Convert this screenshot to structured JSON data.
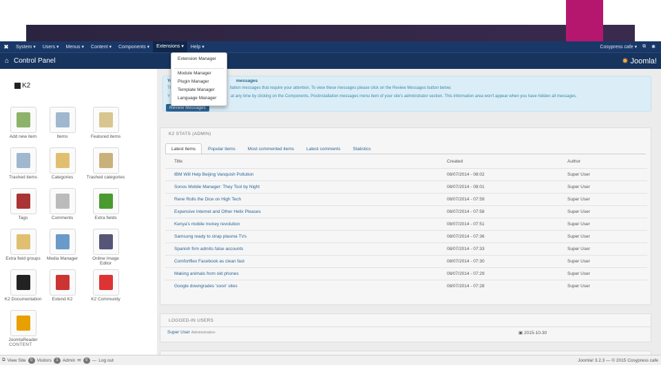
{
  "colors": {
    "menubar": "#1a3867",
    "header": "#17345f",
    "accent": "#b5176f",
    "link": "#2a6496",
    "info": "#dbeef7"
  },
  "menubar": {
    "items": [
      "System ▾",
      "Users ▾",
      "Menus ▾",
      "Content ▾",
      "Components ▾",
      "Extensions ▾",
      "Help ▾"
    ],
    "user": "Cosypress cafe ▾",
    "ext_icon": "external-link-icon",
    "settings_icon": "gear-icon"
  },
  "header": {
    "title": "Control Panel",
    "brand": "Joomla!"
  },
  "dropdown": [
    "Extension Manager",
    "Module Manager",
    "Plugin Manager",
    "Template Manager",
    "Language Manager"
  ],
  "k2": {
    "title": "K2",
    "tiles": [
      {
        "label": "Add new item",
        "icon": "add-item-icon",
        "color": "#8db36a"
      },
      {
        "label": "Items",
        "icon": "items-icon",
        "color": "#9fb7cf"
      },
      {
        "label": "Featured items",
        "icon": "featured-items-icon",
        "color": "#d9c58f"
      },
      {
        "label": "Trashed items",
        "icon": "trashed-items-icon",
        "color": "#9fb7cf"
      },
      {
        "label": "Categories",
        "icon": "categories-icon",
        "color": "#e0c070"
      },
      {
        "label": "Trashed categories",
        "icon": "trashed-categories-icon",
        "color": "#c9b27a"
      },
      {
        "label": "Tags",
        "icon": "tags-icon",
        "color": "#a33"
      },
      {
        "label": "Comments",
        "icon": "comments-icon",
        "color": "#bbb"
      },
      {
        "label": "Extra fields",
        "icon": "extra-fields-icon",
        "color": "#4a9a30"
      },
      {
        "label": "Extra field groups",
        "icon": "extra-field-groups-icon",
        "color": "#e0c070"
      },
      {
        "label": "Media Manager",
        "icon": "media-manager-icon",
        "color": "#6a9ac9"
      },
      {
        "label": "Online Image Editor",
        "icon": "image-editor-icon",
        "color": "#557"
      },
      {
        "label": "K2 Documentation",
        "icon": "documentation-icon",
        "color": "#222"
      },
      {
        "label": "Extend K2",
        "icon": "extend-icon",
        "color": "#c33"
      },
      {
        "label": "K2 Community",
        "icon": "community-icon",
        "color": "#d33"
      },
      {
        "label": "JoomlaReader",
        "icon": "joomlareader-icon",
        "color": "#e8a000"
      }
    ],
    "content_label": "CONTENT"
  },
  "alert": {
    "heading_a": "Yo",
    "heading_b": "messages",
    "line1_a": "Th",
    "line1_b": "llation messages that require your attention. To view these messages please click on the Review Messages button below.",
    "line2_a": "Y",
    "line2_b": "at any time by clicking on the Components, Postinstallation messages menu item of your site's administrator section. This information area won't appear when you have hidden all messages.",
    "button": "Review Messages"
  },
  "stats": {
    "title": "K2 STATS (ADMIN)",
    "tabs": [
      "Latest items",
      "Popular items",
      "Most commented items",
      "Latest comments",
      "Statistics"
    ],
    "columns": [
      "Title",
      "Created",
      "Author"
    ],
    "rows": [
      {
        "title": "IBM Will Help Beijing Vanquish Pollution",
        "created": "08/07/2014 - 08:02",
        "author": "Super User"
      },
      {
        "title": "Sonos Mobile Manager: They Tool by Night",
        "created": "08/07/2014 - 08:01",
        "author": "Super User"
      },
      {
        "title": "Rene Rolls the Dice on High Tech",
        "created": "08/07/2014 - 07:59",
        "author": "Super User"
      },
      {
        "title": "Expensive Internet and Other Helix Pleases",
        "created": "08/07/2014 - 07:58",
        "author": "Super User"
      },
      {
        "title": "Kenya's mobile money revolution",
        "created": "08/07/2014 - 07:51",
        "author": "Super User"
      },
      {
        "title": "Samsung ready to strap plasma TVs",
        "created": "08/07/2014 - 07:36",
        "author": "Super User"
      },
      {
        "title": "Spanish firm admits false accounts",
        "created": "08/07/2014 - 07:33",
        "author": "Super User"
      },
      {
        "title": "Comfortflex Facebook as clean fast",
        "created": "08/07/2014 - 07:30",
        "author": "Super User"
      },
      {
        "title": "Making animals from old phones",
        "created": "08/07/2014 - 07:29",
        "author": "Super User"
      },
      {
        "title": "Google downgrades 'soon' sites",
        "created": "08/07/2014 - 07:28",
        "author": "Super User"
      }
    ]
  },
  "logged": {
    "title": "LOGGED-IN USERS",
    "user": "Super User",
    "user_sub": "Administration",
    "date": "2015-10-30"
  },
  "footer": {
    "view_site": "View Site",
    "visitors_count": "0",
    "visitors": "Visitors",
    "admin_count": "1",
    "admin": "Admin",
    "messages_count": "0",
    "logout": "Log out",
    "version": "Joomla! 3.2.3 — © 2015 Cosypress cafe"
  }
}
